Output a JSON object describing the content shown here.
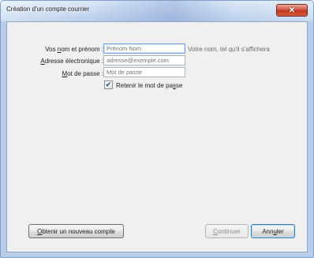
{
  "window": {
    "title": "Création d'un compte courrier",
    "close_glyph": "✕"
  },
  "form": {
    "name": {
      "label_pre": "Vos ",
      "label_key": "n",
      "label_post": "om et prénom :",
      "placeholder": "Prénom Nom",
      "hint": "Votre nom, tel qu'il s'affichera"
    },
    "email": {
      "label_key": "A",
      "label_post": "dresse électronique :",
      "placeholder": "adresse@exemple.com"
    },
    "password": {
      "label_key": "M",
      "label_post": "ot de passe :",
      "placeholder": "Mot de passe"
    },
    "remember": {
      "checked": true,
      "check_glyph": "✔",
      "label_pre": "Retenir le mot de pa",
      "label_key": "s",
      "label_post": "se"
    }
  },
  "buttons": {
    "new_account": {
      "key": "O",
      "rest": "btenir un nouveau compte"
    },
    "continue": {
      "key": "C",
      "rest": "ontinuer",
      "disabled": true
    },
    "cancel": {
      "pre": "Ann",
      "key": "u",
      "post": "ler"
    }
  }
}
